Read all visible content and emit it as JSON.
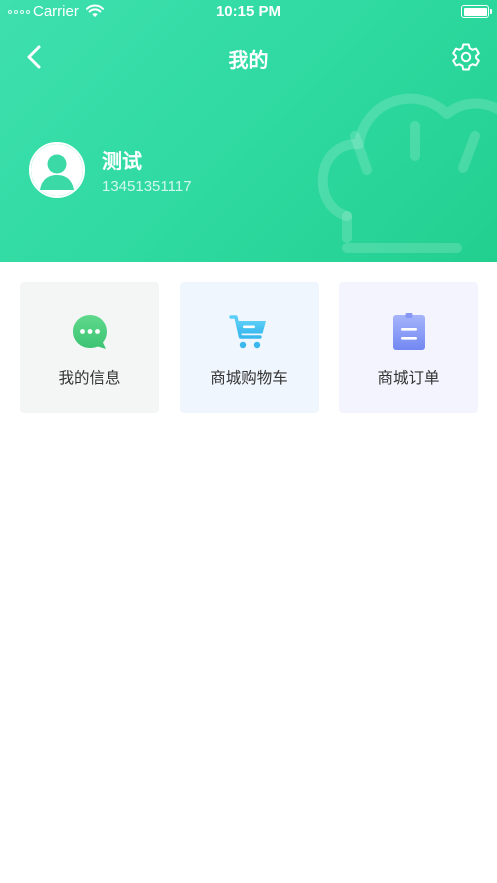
{
  "status_bar": {
    "carrier": "Carrier",
    "time": "10:15 PM"
  },
  "nav": {
    "title": "我的"
  },
  "user": {
    "name": "测试",
    "phone": "13451351117"
  },
  "cards": [
    {
      "label": "我的信息",
      "icon": "chat-bubble-icon",
      "color": "#4ccf7e"
    },
    {
      "label": "商城购物车",
      "icon": "shopping-cart-icon",
      "color": "#4cc3f2"
    },
    {
      "label": "商城订单",
      "icon": "order-document-icon",
      "color": "#7f95f5"
    }
  ],
  "colors": {
    "header_gradient_start": "#3ee0ad",
    "header_gradient_end": "#22cf8f"
  }
}
